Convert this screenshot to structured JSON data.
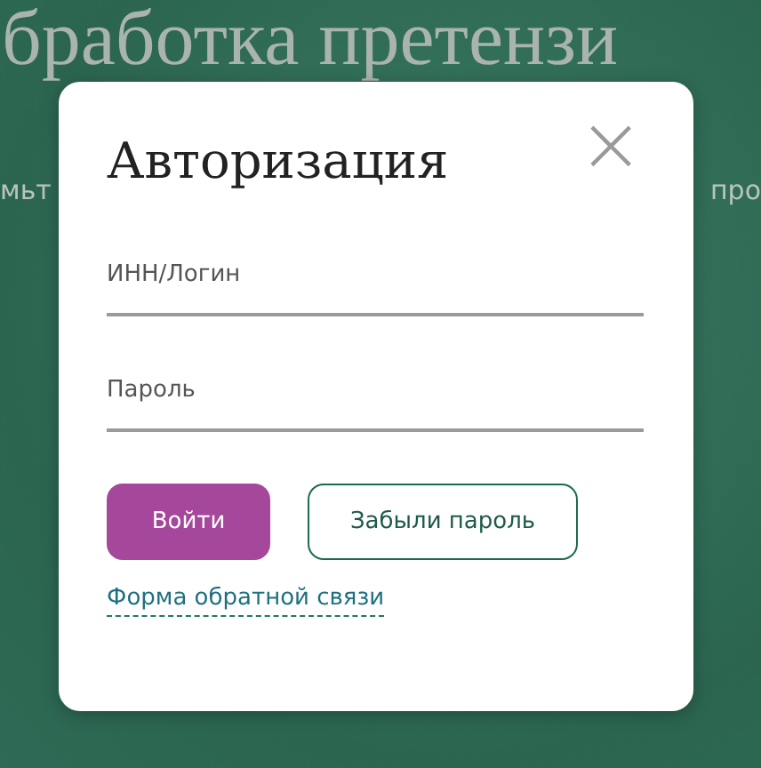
{
  "background": {
    "heading": "бработка претензи",
    "subtitle_left": "мьт",
    "subtitle_right": "про"
  },
  "dialog": {
    "title": "Авторизация",
    "close": "×",
    "fields": [
      {
        "placeholder": "ИНН/Логин"
      },
      {
        "placeholder": "Пароль"
      }
    ],
    "buttons": [
      {
        "label": "Войти",
        "kind": "primary"
      },
      {
        "label": "Забыли пароль",
        "kind": "secondary"
      }
    ],
    "link": "Форма обратной связи"
  }
}
